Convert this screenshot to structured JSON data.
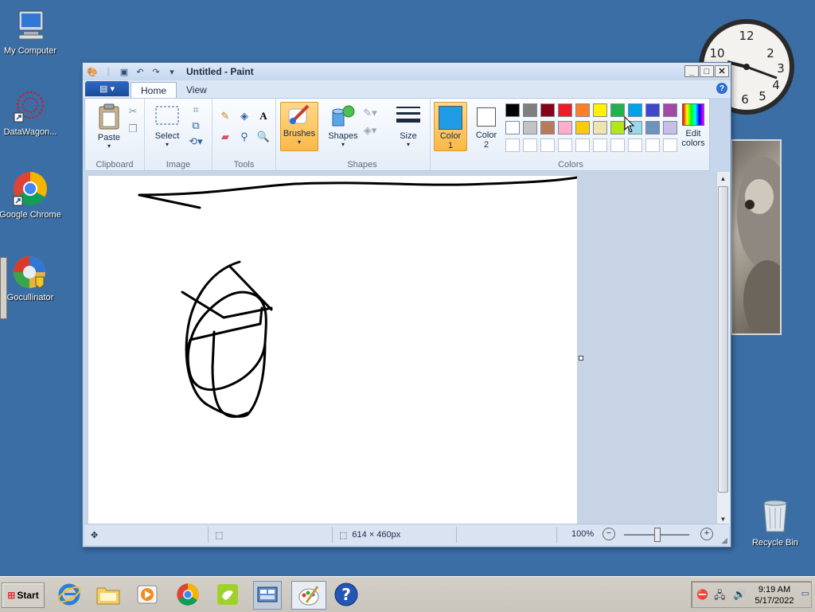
{
  "desktop": {
    "icons": [
      {
        "label": "My Computer"
      },
      {
        "label": "DataWagon..."
      },
      {
        "label": "Google Chrome"
      },
      {
        "label": "Gocullinator"
      },
      {
        "label": "Recycle Bin"
      }
    ]
  },
  "paint": {
    "title": "Untitled - Paint",
    "tabs": [
      "Home",
      "View"
    ],
    "groups": {
      "clipboard": "Clipboard",
      "image": "Image",
      "tools": "Tools",
      "shapes": "Shapes",
      "colors": "Colors"
    },
    "buttons": {
      "paste": "Paste",
      "select": "Select",
      "brushes": "Brushes",
      "shapes": "Shapes",
      "size": "Size",
      "color1_a": "Color",
      "color1_b": "1",
      "color2_a": "Color",
      "color2_b": "2",
      "edit_a": "Edit",
      "edit_b": "colors"
    },
    "colors": {
      "color1": "#1e9de6",
      "color2": "#ffffff",
      "palette_row1": [
        "#000000",
        "#7f7f7f",
        "#880015",
        "#ed1c24",
        "#ff7f27",
        "#fff200",
        "#22b14c",
        "#00a2e8",
        "#3f48cc",
        "#a349a4"
      ],
      "palette_row2": [
        "#ffffff",
        "#c3c3c3",
        "#b97a57",
        "#ffaec9",
        "#ffc90e",
        "#efe4b0",
        "#b5e61d",
        "#99d9ea",
        "#7092be",
        "#c8bfe7"
      ]
    },
    "status": {
      "size": "614 × 460px",
      "zoom": "100%"
    }
  },
  "taskbar": {
    "start": "Start",
    "time": "9:19 AM",
    "date": "5/17/2022"
  }
}
